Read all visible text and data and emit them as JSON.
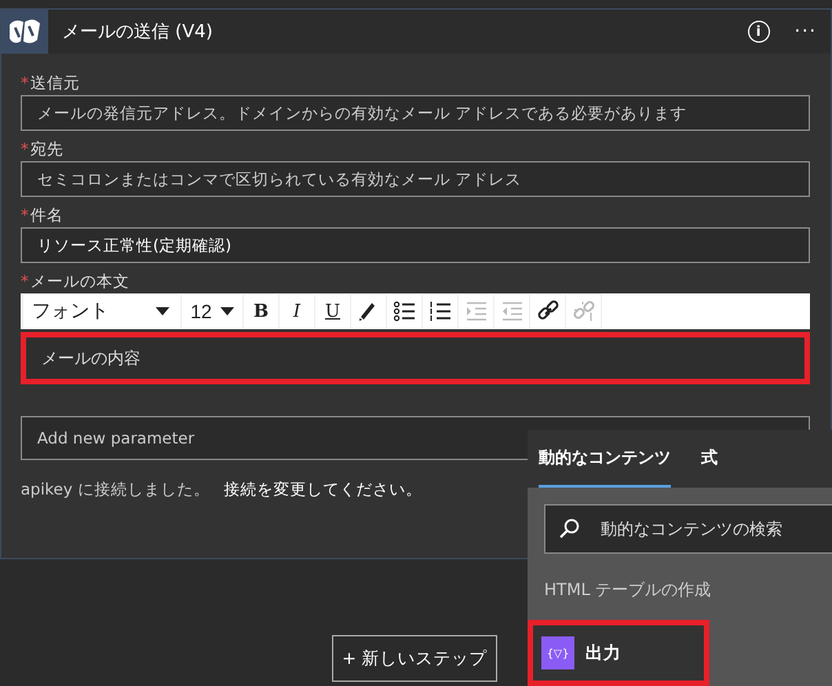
{
  "card": {
    "title": "メールの送信 (V4)",
    "info_icon": "i",
    "more": "···"
  },
  "fields": [
    {
      "label": "送信元",
      "required_mark": "*",
      "placeholder": "メールの発信元アドレス。ドメインからの有効なメール アドレスである必要があります"
    },
    {
      "label": "宛先",
      "required_mark": "*",
      "placeholder": "セミコロンまたはコンマで区切られている有効なメール アドレス"
    },
    {
      "label": "件名",
      "required_mark": "*",
      "value": "リソース正常性(定期確認)"
    }
  ],
  "body": {
    "label": "メールの本文",
    "required_mark": "*",
    "value": "メールの内容",
    "highlighted": true,
    "toolbar": [
      {
        "kind": "font",
        "text": "フォント"
      },
      {
        "kind": "size",
        "text": "12"
      },
      {
        "kind": "bold",
        "text": "B",
        "disabled": false
      },
      {
        "kind": "italic",
        "text": "I",
        "disabled": false
      },
      {
        "kind": "underline",
        "text": "U",
        "disabled": false
      },
      {
        "kind": "pen",
        "disabled": false
      },
      {
        "kind": "bullets",
        "disabled": false
      },
      {
        "kind": "numbers",
        "disabled": false
      },
      {
        "kind": "indent",
        "disabled": true
      },
      {
        "kind": "outdent",
        "disabled": true
      },
      {
        "kind": "link",
        "disabled": false
      },
      {
        "kind": "unlink",
        "disabled": true
      }
    ]
  },
  "add_parameter": {
    "placeholder": "Add new parameter"
  },
  "connection": {
    "status": "apikey に接続しました。",
    "link": "接続を変更してください。"
  },
  "new_step": "+ 新しいステップ",
  "dynamic": {
    "tabs": [
      {
        "label": "動的なコンテンツ",
        "selected": true
      },
      {
        "label": "式",
        "selected": false
      }
    ],
    "search": {
      "placeholder": "動的なコンテンツの検索"
    },
    "section": "HTML テーブルの作成",
    "items": [
      {
        "label": "出力",
        "icon": "{▽}",
        "highlighted": true
      }
    ]
  }
}
